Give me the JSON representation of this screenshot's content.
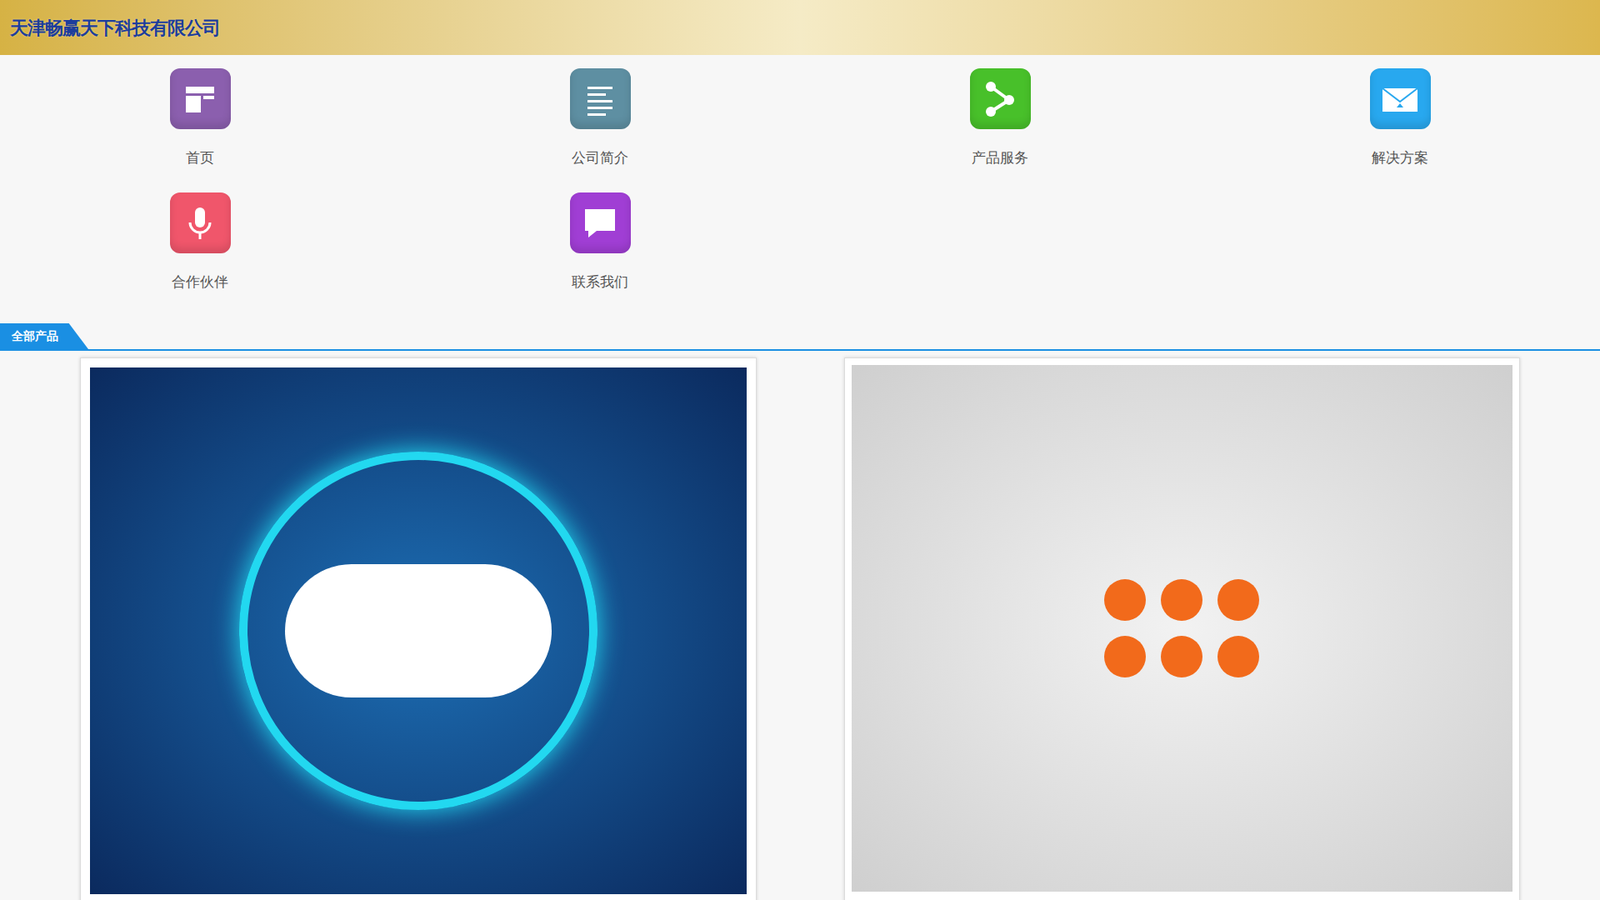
{
  "header": {
    "title": "天津畅赢天下科技有限公司"
  },
  "nav": {
    "items": [
      {
        "label": "首页",
        "color": "#8b5fae"
      },
      {
        "label": "公司简介",
        "color": "#5e8fa2"
      },
      {
        "label": "产品服务",
        "color": "#48c02a"
      },
      {
        "label": "解决方案",
        "color": "#28a8ef"
      },
      {
        "label": "合作伙伴",
        "color": "#f0566b"
      },
      {
        "label": "联系我们",
        "color": "#a03ed4"
      }
    ]
  },
  "section": {
    "tab": "全部产品"
  }
}
